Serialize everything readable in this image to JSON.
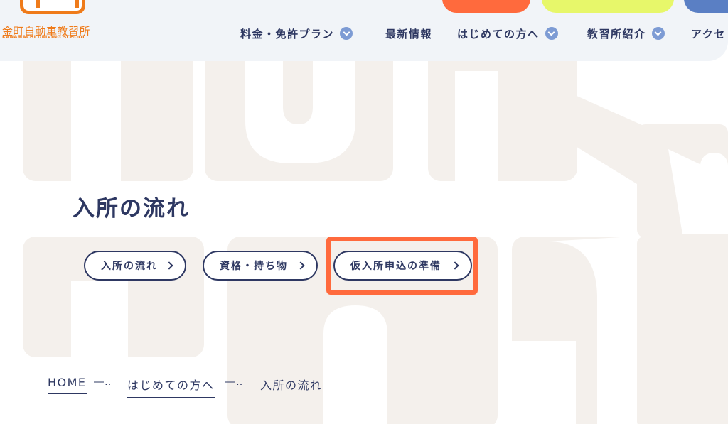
{
  "brand": {
    "name": "金町自動車教習所",
    "sub": "KANAMACHI DRIVING SCHOOL"
  },
  "nav": {
    "items": [
      {
        "label": "料金・免許プラン",
        "has_dropdown": true
      },
      {
        "label": "最新情報",
        "has_dropdown": false
      },
      {
        "label": "はじめての方へ",
        "has_dropdown": true
      },
      {
        "label": "教習所紹介",
        "has_dropdown": true
      },
      {
        "label": "アクセ",
        "has_dropdown": false
      }
    ]
  },
  "page": {
    "title": "入所の流れ"
  },
  "subnav": {
    "buttons": [
      {
        "label": "入所の流れ"
      },
      {
        "label": "資格・持ち物"
      },
      {
        "label": "仮入所申込の準備",
        "highlighted": true
      }
    ]
  },
  "breadcrumb": {
    "items": [
      "HOME",
      "はじめての方へ",
      "入所の流れ"
    ],
    "separator": "―‥"
  },
  "colors": {
    "navy": "#2e3862",
    "brand_orange": "#ef7b1a",
    "highlight": "#ff6a3d",
    "lime": "#e7f76a",
    "blue": "#5a7fc4",
    "beige": "#f4f0ec",
    "header_bg": "#f1f4f8"
  },
  "icons": {
    "dropdown": "chevron-down-icon",
    "pill_arrow": "chevron-right-icon"
  }
}
